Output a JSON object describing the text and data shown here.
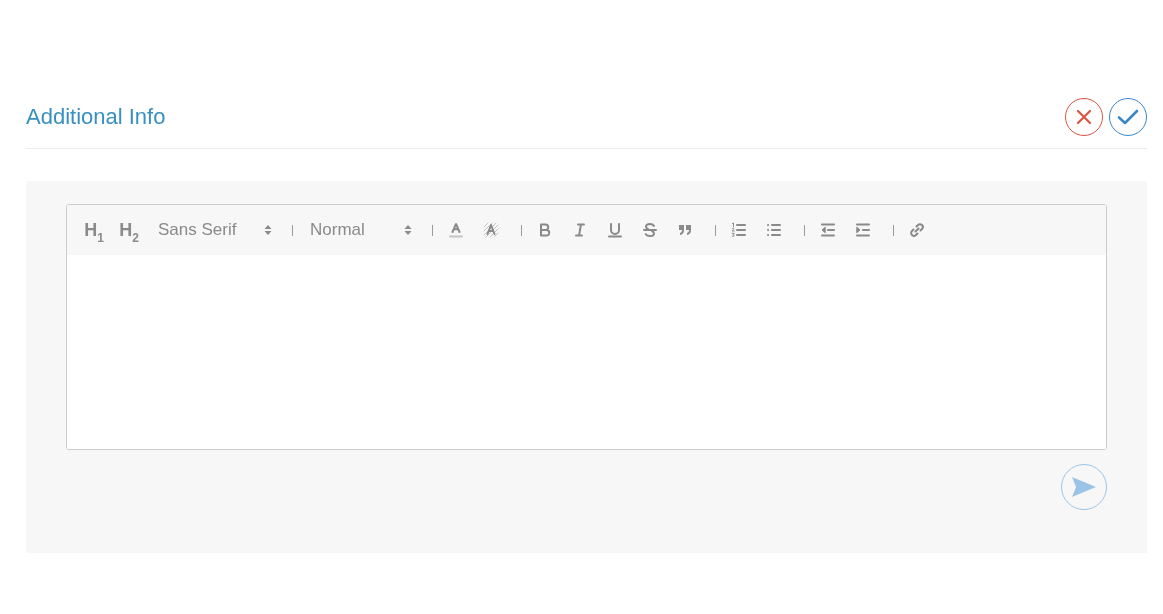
{
  "header": {
    "title": "Additional Info"
  },
  "editor": {
    "toolbar": {
      "headings": [
        "H$_{1}$",
        "H$_{2}$"
      ],
      "font_picker": {
        "value": "Sans Serif"
      },
      "size_picker": {
        "value": "Normal"
      }
    }
  }
}
